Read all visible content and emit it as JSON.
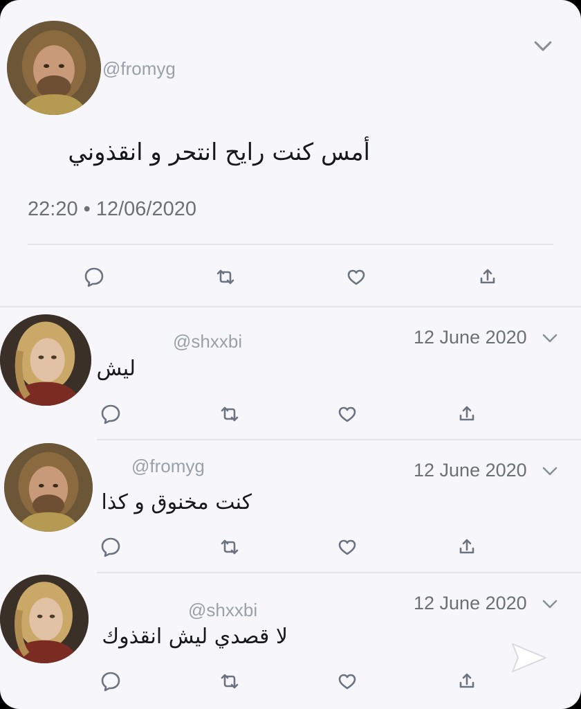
{
  "main_tweet": {
    "handle": "@fromyg",
    "text": "أمس كنت رايح انتحر و انقذوني",
    "timestamp": "22:20 • 12/06/2020",
    "avatar": "tyrion-avatar"
  },
  "replies": [
    {
      "handle": "@shxxbi",
      "date": "12 June 2020",
      "text": "ليش",
      "avatar": "cersei-avatar"
    },
    {
      "handle": "@fromyg",
      "date": "12 June 2020",
      "text": "كنت مخنوق و كذا",
      "avatar": "tyrion-avatar"
    },
    {
      "handle": "@shxxbi",
      "date": "12 June 2020",
      "text": "لا قصدي ليش انقذوك",
      "avatar": "cersei-avatar"
    }
  ],
  "icons": [
    "reply-icon",
    "retweet-icon",
    "like-icon",
    "share-icon",
    "chevron-down-icon",
    "send-icon"
  ],
  "colors": {
    "background": "#f7f7fb",
    "icon": "#6b7280",
    "text": "#16181a",
    "muted": "#9aa0a8"
  }
}
